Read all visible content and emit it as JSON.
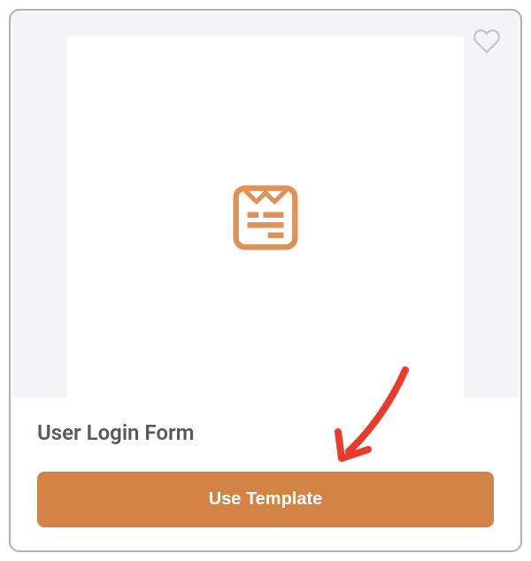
{
  "template": {
    "title": "User Login Form",
    "button_label": "Use Template"
  },
  "colors": {
    "accent": "#d38345",
    "annotation": "#e63b2f"
  }
}
